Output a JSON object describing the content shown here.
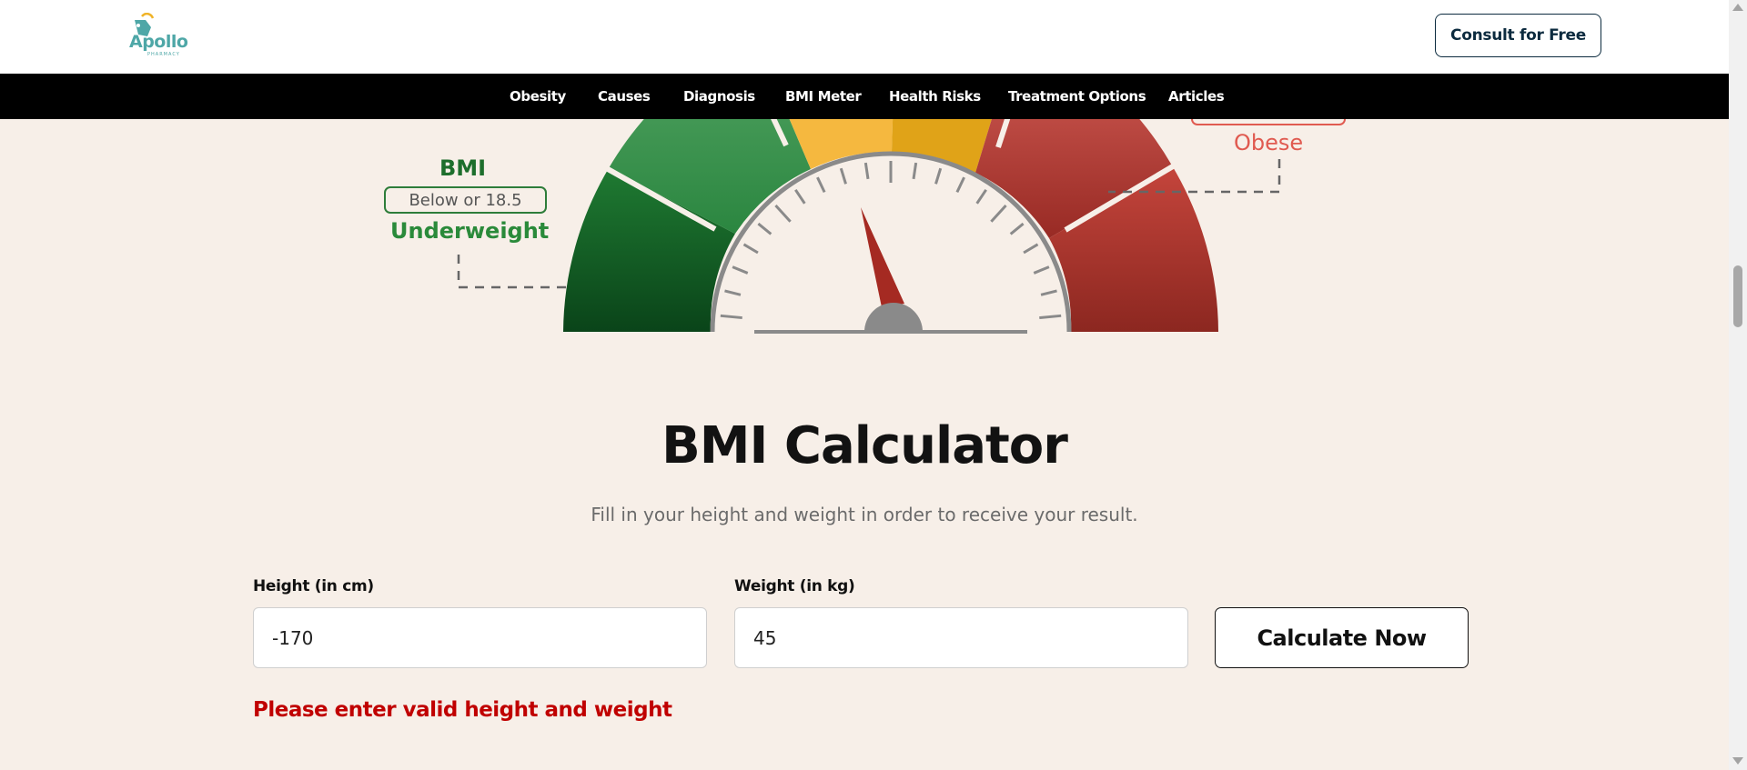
{
  "header": {
    "logo_text": "Apollo",
    "logo_sub": "PHARMACY",
    "consult_label": "Consult for Free"
  },
  "nav": {
    "items": [
      "Obesity",
      "Causes",
      "Diagnosis",
      "BMI Meter",
      "Health Risks",
      "Treatment Options",
      "Articles"
    ]
  },
  "gauge": {
    "left_heading": "BMI",
    "left_range": "Below or 18.5",
    "left_category": "Underweight",
    "right_category": "Obese"
  },
  "calculator": {
    "title": "BMI Calculator",
    "subtitle": "Fill in your height and weight in order to receive your result.",
    "height_label": "Height (in cm)",
    "height_value": "-170",
    "weight_label": "Weight (in kg)",
    "weight_value": "45",
    "button_label": "Calculate Now",
    "error": "Please enter valid height and weight"
  },
  "colors": {
    "error": "#c00000",
    "nav_bg": "#000000",
    "page_bg": "#f7efe8",
    "accent_teal": "#4ea7a7"
  }
}
